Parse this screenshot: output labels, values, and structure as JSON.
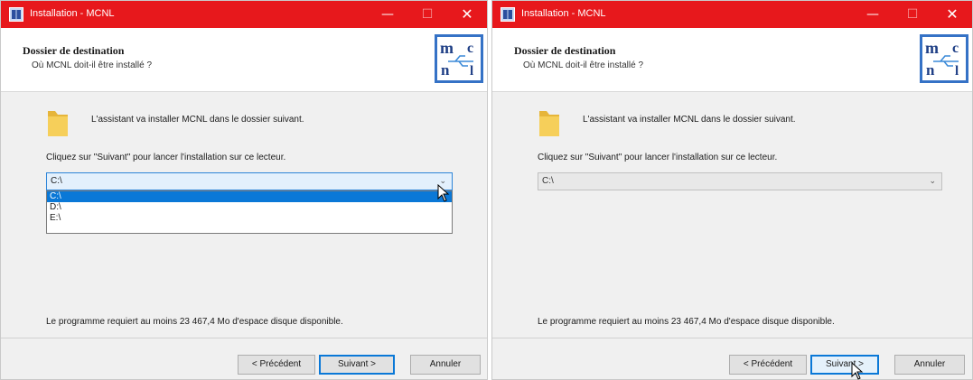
{
  "window": {
    "title": "Installation - MCNL",
    "minimize_glyph": "—",
    "maximize_glyph": "☐",
    "close_glyph": "✕"
  },
  "header": {
    "title": "Dossier de destination",
    "subtitle": "Où MCNL doit-il être installé ?",
    "logo_letters": {
      "top_left": "m",
      "top_right": "c",
      "bottom_left": "n",
      "bottom_right": "l"
    },
    "logo_icon": "usb-trident-icon"
  },
  "body": {
    "intro_text": "L'assistant va installer MCNL dans le dossier suivant.",
    "intro_icon": "folder-icon",
    "instruction_text": "Cliquez sur \"Suivant\" pour lancer l'installation sur ce lecteur.",
    "space_text": "Le programme requiert au moins 23 467,4 Mo d'espace disque disponible."
  },
  "drive_select": {
    "selected_value": "C:\\",
    "options": [
      "C:\\",
      "D:\\",
      "E:\\"
    ],
    "dropdown_open_left": true,
    "dropdown_open_right": false
  },
  "buttons": {
    "back_label": "< Précédent",
    "next_label": "Suivant >",
    "cancel_label": "Annuler"
  },
  "colors": {
    "titlebar": "#e7181c",
    "accent": "#0a78d7",
    "logo_border": "#3572c6"
  }
}
